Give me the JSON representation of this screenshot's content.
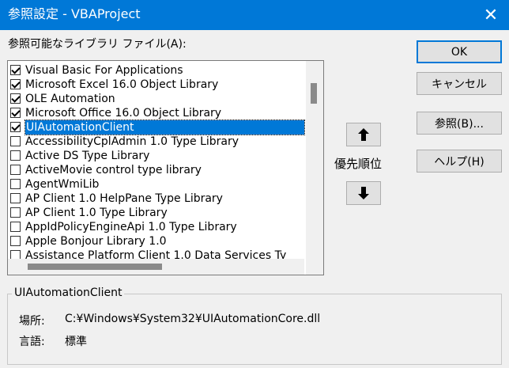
{
  "window": {
    "title": "参照設定 - VBAProject"
  },
  "list_label": "参照可能なライブラリ ファイル(A):",
  "items": [
    {
      "label": "Visual Basic For Applications",
      "checked": true
    },
    {
      "label": "Microsoft Excel 16.0 Object Library",
      "checked": true
    },
    {
      "label": "OLE Automation",
      "checked": true
    },
    {
      "label": "Microsoft Office 16.0 Object Library",
      "checked": true
    },
    {
      "label": "UIAutomationClient",
      "checked": true,
      "selected": true
    },
    {
      "label": "AccessibilityCplAdmin 1.0 Type Library",
      "checked": false
    },
    {
      "label": "Active DS Type Library",
      "checked": false
    },
    {
      "label": "ActiveMovie control type library",
      "checked": false
    },
    {
      "label": "AgentWmiLib",
      "checked": false
    },
    {
      "label": "AP Client 1.0 HelpPane Type Library",
      "checked": false
    },
    {
      "label": "AP Client 1.0 Type Library",
      "checked": false
    },
    {
      "label": "AppIdPolicyEngineApi 1.0 Type Library",
      "checked": false
    },
    {
      "label": "Apple Bonjour Library 1.0",
      "checked": false
    },
    {
      "label": "Assistance Platform Client 1.0 Data Services Ty",
      "checked": false
    }
  ],
  "buttons": {
    "ok": "OK",
    "cancel": "キャンセル",
    "browse": "参照(B)...",
    "help": "ヘルプ(H)"
  },
  "priority_label": "優先順位",
  "group": {
    "title": "UIAutomationClient",
    "location_label": "場所:",
    "location_value": "C:¥Windows¥System32¥UIAutomationCore.dll",
    "language_label": "言語:",
    "language_value": "標準"
  }
}
